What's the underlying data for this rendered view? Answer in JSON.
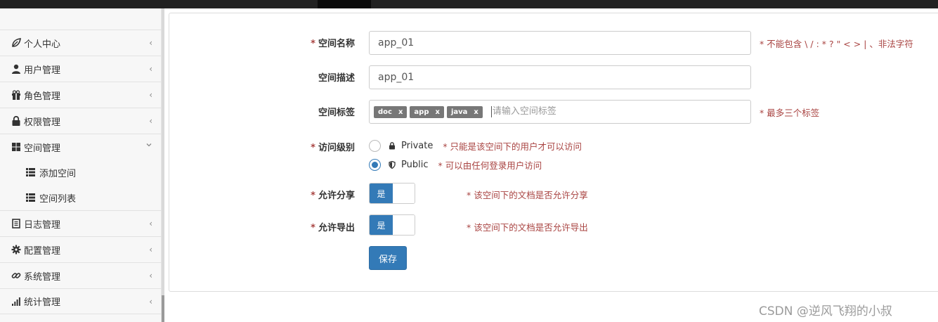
{
  "sidebar": {
    "items": [
      {
        "label": "个人中心",
        "icon": "leaf-icon"
      },
      {
        "label": "用户管理",
        "icon": "user-icon"
      },
      {
        "label": "角色管理",
        "icon": "gift-icon"
      },
      {
        "label": "权限管理",
        "icon": "lock-icon"
      },
      {
        "label": "空间管理",
        "icon": "grid-icon",
        "expanded": true,
        "children": [
          {
            "label": "添加空间",
            "icon": "list-icon"
          },
          {
            "label": "空间列表",
            "icon": "list-icon"
          }
        ]
      },
      {
        "label": "日志管理",
        "icon": "book-icon"
      },
      {
        "label": "配置管理",
        "icon": "gear-icon"
      },
      {
        "label": "系统管理",
        "icon": "link-icon"
      },
      {
        "label": "统计管理",
        "icon": "bar-chart-icon"
      }
    ]
  },
  "form": {
    "space_name": {
      "label": "空间名称",
      "required_mark": "*",
      "value": "app_01",
      "hint": "* 不能包含 \\ / : * ? \" < > | 、非法字符"
    },
    "space_desc": {
      "label": "空间描述",
      "value": "app_01"
    },
    "space_tags": {
      "label": "空间标签",
      "tags": [
        "doc",
        "app",
        "java"
      ],
      "tag_remove": "x",
      "placeholder": "请输入空间标签",
      "hint": "* 最多三个标签"
    },
    "access_level": {
      "label": "访问级别",
      "required_mark": "*",
      "options": [
        {
          "label": "Private",
          "hint": "* 只能是该空间下的用户才可以访问",
          "checked": false
        },
        {
          "label": "Public",
          "hint": "* 可以由任何登录用户访问",
          "checked": true
        }
      ]
    },
    "allow_share": {
      "label": "允许分享",
      "required_mark": "*",
      "value_label": "是",
      "hint": "* 该空间下的文档是否允许分享"
    },
    "allow_export": {
      "label": "允许导出",
      "required_mark": "*",
      "value_label": "是",
      "hint": "* 该空间下的文档是否允许导出"
    },
    "save_label": "保存"
  },
  "watermark": "CSDN @逆风飞翔的小叔",
  "colors": {
    "primary": "#337ab7",
    "hint": "#a94442",
    "tag": "#777777"
  }
}
